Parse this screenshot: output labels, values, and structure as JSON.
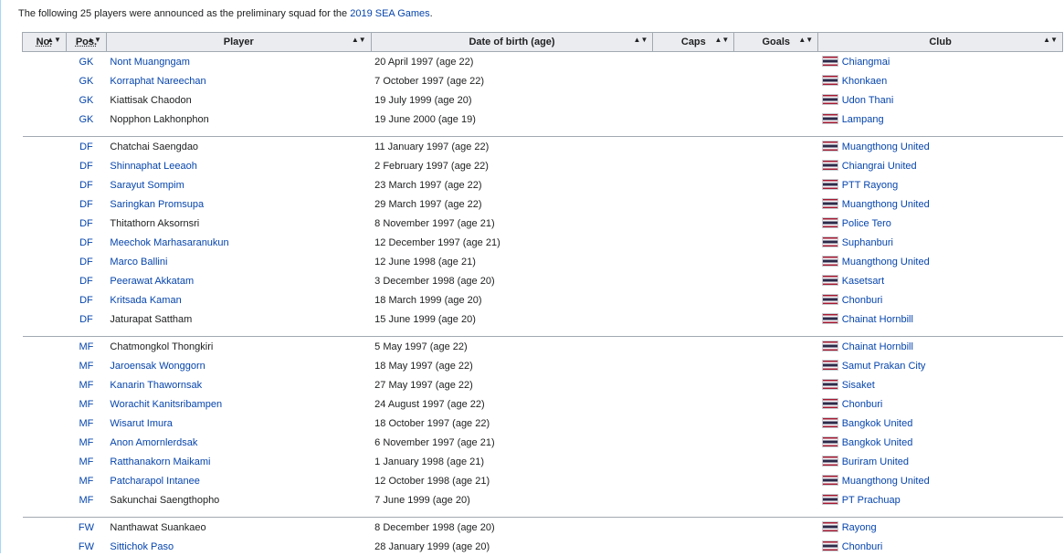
{
  "intro": {
    "before": "The following 25 players were announced as the preliminary squad for the ",
    "link": "2019 SEA Games",
    "after": "."
  },
  "headers": {
    "no": "No.",
    "pos": "Pos.",
    "player": "Player",
    "dob": "Date of birth (age)",
    "caps": "Caps",
    "goals": "Goals",
    "club": "Club"
  },
  "groups": [
    {
      "players": [
        {
          "pos": "GK",
          "name": "Nont Muangngam",
          "link": true,
          "dob": "20 April 1997 (age 22)",
          "club": "Chiangmai"
        },
        {
          "pos": "GK",
          "name": "Korraphat Nareechan",
          "link": true,
          "dob": "7 October 1997 (age 22)",
          "club": "Khonkaen"
        },
        {
          "pos": "GK",
          "name": "Kiattisak Chaodon",
          "link": false,
          "dob": "19 July 1999 (age 20)",
          "club": "Udon Thani"
        },
        {
          "pos": "GK",
          "name": "Nopphon Lakhonphon",
          "link": false,
          "dob": "19 June 2000 (age 19)",
          "club": "Lampang"
        }
      ]
    },
    {
      "players": [
        {
          "pos": "DF",
          "name": "Chatchai Saengdao",
          "link": false,
          "dob": "11 January 1997 (age 22)",
          "club": "Muangthong United"
        },
        {
          "pos": "DF",
          "name": "Shinnaphat Leeaoh",
          "link": true,
          "dob": "2 February 1997 (age 22)",
          "club": "Chiangrai United"
        },
        {
          "pos": "DF",
          "name": "Sarayut Sompim",
          "link": true,
          "dob": "23 March 1997 (age 22)",
          "club": "PTT Rayong"
        },
        {
          "pos": "DF",
          "name": "Saringkan Promsupa",
          "link": true,
          "dob": "29 March 1997 (age 22)",
          "club": "Muangthong United"
        },
        {
          "pos": "DF",
          "name": "Thitathorn Aksornsri",
          "link": false,
          "dob": "8 November 1997 (age 21)",
          "club": "Police Tero"
        },
        {
          "pos": "DF",
          "name": "Meechok Marhasaranukun",
          "link": true,
          "dob": "12 December 1997 (age 21)",
          "club": "Suphanburi"
        },
        {
          "pos": "DF",
          "name": "Marco Ballini",
          "link": true,
          "dob": "12 June 1998 (age 21)",
          "club": "Muangthong United"
        },
        {
          "pos": "DF",
          "name": "Peerawat Akkatam",
          "link": true,
          "dob": "3 December 1998 (age 20)",
          "club": "Kasetsart"
        },
        {
          "pos": "DF",
          "name": "Kritsada Kaman",
          "link": true,
          "dob": "18 March 1999 (age 20)",
          "club": "Chonburi"
        },
        {
          "pos": "DF",
          "name": "Jaturapat Sattham",
          "link": false,
          "dob": "15 June 1999 (age 20)",
          "club": "Chainat Hornbill"
        }
      ]
    },
    {
      "players": [
        {
          "pos": "MF",
          "name": "Chatmongkol Thongkiri",
          "link": false,
          "dob": "5 May 1997 (age 22)",
          "club": "Chainat Hornbill"
        },
        {
          "pos": "MF",
          "name": "Jaroensak Wonggorn",
          "link": true,
          "dob": "18 May 1997 (age 22)",
          "club": "Samut Prakan City"
        },
        {
          "pos": "MF",
          "name": "Kanarin Thawornsak",
          "link": true,
          "dob": "27 May 1997 (age 22)",
          "club": "Sisaket"
        },
        {
          "pos": "MF",
          "name": "Worachit Kanitsribampen",
          "link": true,
          "dob": "24 August 1997 (age 22)",
          "club": "Chonburi"
        },
        {
          "pos": "MF",
          "name": "Wisarut Imura",
          "link": true,
          "dob": "18 October 1997 (age 22)",
          "club": "Bangkok United"
        },
        {
          "pos": "MF",
          "name": "Anon Amornlerdsak",
          "link": true,
          "dob": "6 November 1997 (age 21)",
          "club": "Bangkok United"
        },
        {
          "pos": "MF",
          "name": "Ratthanakorn Maikami",
          "link": true,
          "dob": "1 January 1998 (age 21)",
          "club": "Buriram United"
        },
        {
          "pos": "MF",
          "name": "Patcharapol Intanee",
          "link": true,
          "dob": "12 October 1998 (age 21)",
          "club": "Muangthong United"
        },
        {
          "pos": "MF",
          "name": "Sakunchai Saengthopho",
          "link": false,
          "dob": "7 June 1999 (age 20)",
          "club": "PT Prachuap"
        }
      ]
    },
    {
      "players": [
        {
          "pos": "FW",
          "name": "Nanthawat Suankaeo",
          "link": false,
          "dob": "8 December 1998 (age 20)",
          "club": "Rayong"
        },
        {
          "pos": "FW",
          "name": "Sittichok Paso",
          "link": true,
          "dob": "28 January 1999 (age 20)",
          "club": "Chonburi"
        }
      ]
    }
  ]
}
